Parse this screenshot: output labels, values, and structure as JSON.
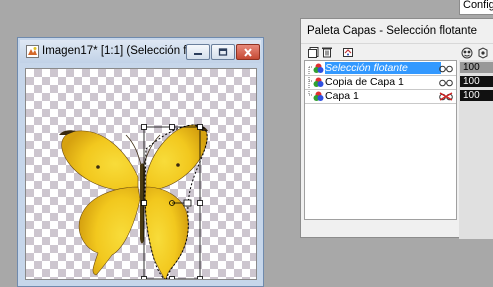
{
  "tooltip": {
    "text": "Configu"
  },
  "image_window": {
    "title": "Imagen17* [1:1] (Selección flotan...",
    "buttons": [
      "minimize",
      "maximize",
      "close"
    ]
  },
  "layers_palette": {
    "title": "Paleta Capas - Selección flotante",
    "layers": [
      {
        "name": "Selección flotante",
        "selected": true,
        "opacity": "100",
        "icon": "floating-selection-icon"
      },
      {
        "name": "Copia de Capa 1",
        "selected": false,
        "opacity": "100",
        "icon": "raster-layer-icon"
      },
      {
        "name": "Capa 1",
        "selected": false,
        "opacity": "100",
        "icon": "raster-layer-icon"
      }
    ]
  },
  "colors": {
    "selection_highlight": "#3399ff",
    "butterfly": "#f2c81e"
  }
}
